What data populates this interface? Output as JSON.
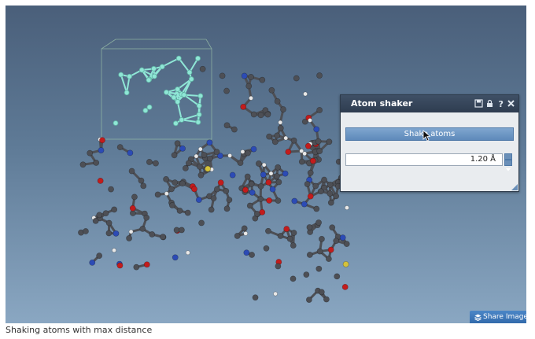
{
  "panel": {
    "title": "Atom shaker",
    "header_icons": [
      "save-icon",
      "lock-icon",
      "help-icon",
      "close-icon"
    ],
    "shake_button_label": "Shake atoms",
    "max_distance_value": "1.20 Å"
  },
  "share_button": {
    "label": "Share Image",
    "icon": "layers-icon"
  },
  "caption": "Shaking atoms with max distance",
  "colors": {
    "carbon": "#4d4f55",
    "oxygen": "#c21c1c",
    "nitrogen": "#2c4bb5",
    "hydrogen": "#e8e8e8",
    "sulfur": "#d4c23a",
    "selection": "#8fe6d6",
    "accent": "#3a77bd"
  }
}
